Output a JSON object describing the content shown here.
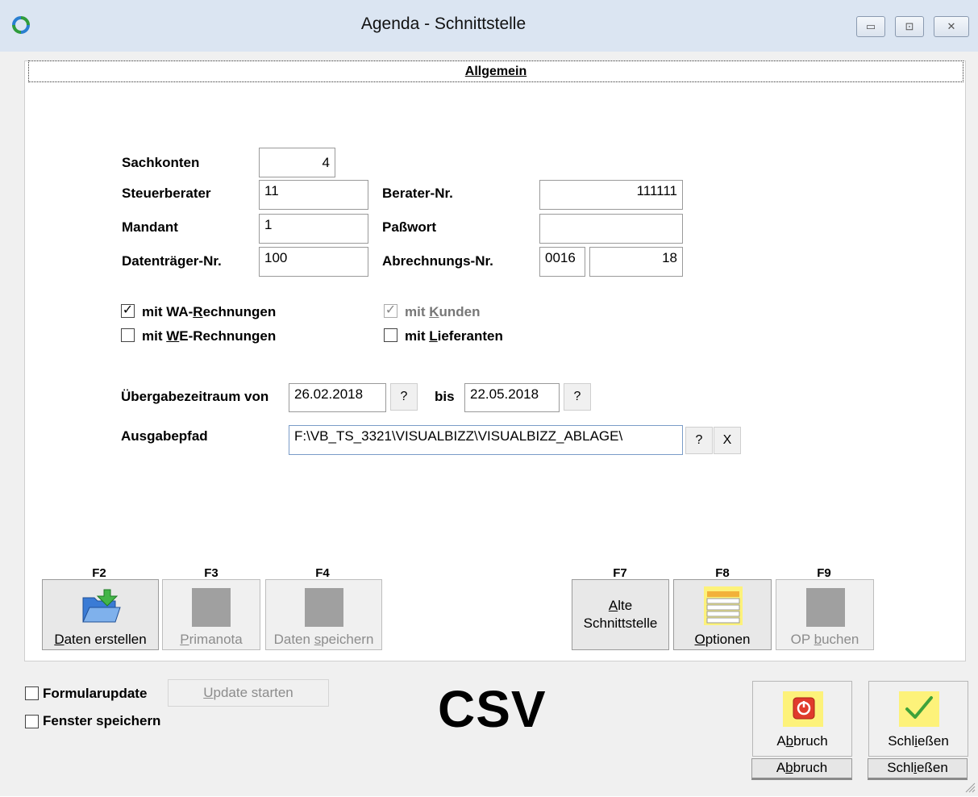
{
  "window": {
    "title": "Agenda - Schnittstelle",
    "controls": {
      "minimize": "▭",
      "restore": "⊡",
      "close": "✕"
    }
  },
  "tab": {
    "label": "Allgemein"
  },
  "form": {
    "sachkonten": {
      "label": "Sachkonten",
      "value": "4"
    },
    "steuerberater": {
      "label": "Steuerberater",
      "value": "11"
    },
    "berater_nr": {
      "label": "Berater-Nr.",
      "value": "111111"
    },
    "mandant": {
      "label": "Mandant",
      "value": "1"
    },
    "passwort": {
      "label": "Paßwort",
      "value": ""
    },
    "datentraeger_nr": {
      "label": "Datenträger-Nr.",
      "value": "100"
    },
    "abrechnungs_nr": {
      "label": "Abrechnungs-Nr.",
      "value_prefix": "0016",
      "value": "18"
    }
  },
  "checkboxes": {
    "wa_rechnungen": {
      "label_pre": "mit WA-",
      "label_ul": "R",
      "label_post": "echnungen",
      "checked": true
    },
    "we_rechnungen": {
      "label_pre": "mit ",
      "label_ul": "W",
      "label_post": "E-Rechnungen",
      "checked": false
    },
    "kunden": {
      "label_pre": "mit ",
      "label_ul": "K",
      "label_post": "unden",
      "checked": true,
      "disabled": true
    },
    "lieferanten": {
      "label_pre": "mit ",
      "label_ul": "L",
      "label_post": "ieferanten",
      "checked": false
    }
  },
  "period": {
    "label_from": "Übergabezeitraum von",
    "from": "26.02.2018",
    "label_to": "bis",
    "to": "22.05.2018",
    "help": "?"
  },
  "output": {
    "label": "Ausgabepfad",
    "path": "F:\\VB_TS_3321\\VISUALBIZZ\\VISUALBIZZ_ABLAGE\\",
    "help": "?",
    "clear": "X"
  },
  "function_buttons": {
    "f2": {
      "key": "F2",
      "label_ul": "D",
      "label_rest": "aten erstellen"
    },
    "f3": {
      "key": "F3",
      "label_ul": "P",
      "label_rest": "rimanota"
    },
    "f4": {
      "key": "F4",
      "label_pre": "Daten ",
      "label_ul": "s",
      "label_rest": "peichern"
    },
    "f7": {
      "key": "F7",
      "line1_ul": "A",
      "line1_rest": "lte",
      "line2": "Schnittstelle"
    },
    "f8": {
      "key": "F8",
      "label_ul": "O",
      "label_rest": "ptionen"
    },
    "f9": {
      "key": "F9",
      "label_pre": "OP ",
      "label_ul": "b",
      "label_rest": "uchen"
    }
  },
  "bottom": {
    "formularupdate": {
      "label": "Formularupdate",
      "checked": false
    },
    "fenster_speichern": {
      "label": "Fenster speichern",
      "checked": false
    },
    "update_button": {
      "label_ul": "U",
      "label_rest": "pdate starten"
    },
    "format": "CSV",
    "abbruch": {
      "label_pre": "A",
      "label_ul": "b",
      "label_rest": "bruch"
    },
    "schliessen": {
      "label_pre": "Schl",
      "label_ul": "i",
      "label_rest": "eßen"
    }
  },
  "colors": {
    "titlebar": "#dbe5f2",
    "frame": "#f0f0f0",
    "cancel_red": "#e03b2c",
    "ok_green": "#3fa33a",
    "icon_yellow_bg": "#fdf27a",
    "folder_blue": "#3a7bd5"
  }
}
